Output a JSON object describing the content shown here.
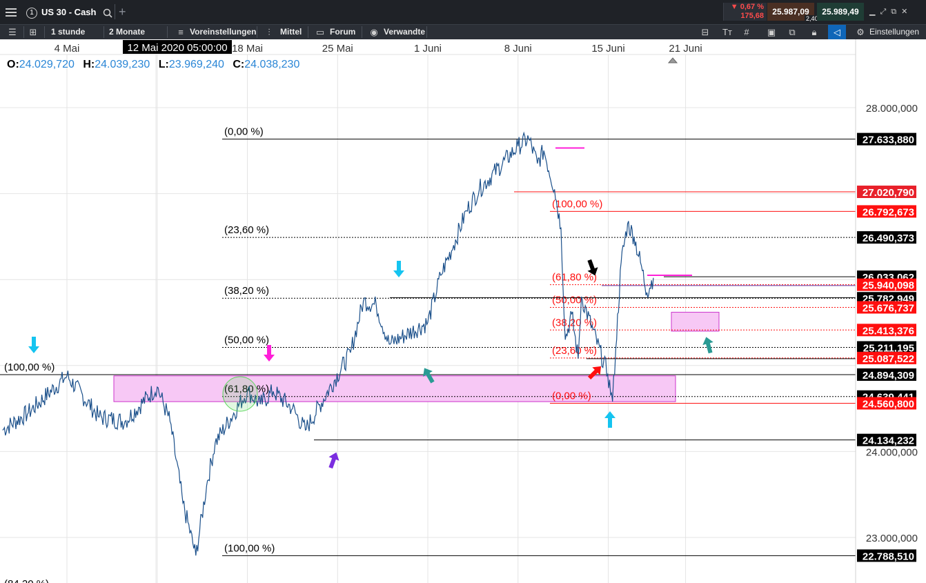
{
  "topbar": {
    "instrument_number": "1",
    "instrument": "US 30 - Cash",
    "change_pct": "0,67 %",
    "change_abs": "175,68",
    "bid": "25.987,09",
    "spread": "2,40",
    "ask": "25.989,49"
  },
  "toolbar": {
    "interval": "1 stunde",
    "range": "2 Monate",
    "presets": "Voreinstellungen",
    "indicator": "Mittel",
    "forum": "Forum",
    "related": "Verwandte",
    "settings": "Einstellungen"
  },
  "ohlc": {
    "o_label": "O:",
    "o_value": "24.029,720",
    "h_label": "H:",
    "h_value": "24.039,230",
    "l_label": "L:",
    "l_value": "23.969,240",
    "c_label": "C:",
    "c_value": "24.038,230"
  },
  "crosshair_date": "12 Mai 2020 05:00:00",
  "chart_data": {
    "type": "line",
    "series": [
      {
        "x": [
          "2020-04-29 00:00",
          "2020-05-01 00:00",
          "2020-05-04 00:00",
          "2020-05-06 12:00",
          "2020-05-08 12:00",
          "2020-05-11 00:00",
          "2020-05-12 00:00",
          "2020-05-13 00:00",
          "2020-05-14 00:00",
          "2020-05-14 20:00",
          "2020-05-15 12:00",
          "2020-05-18 00:00",
          "2020-05-19 00:00",
          "2020-05-20 00:00",
          "2020-05-21 12:00",
          "2020-05-22 12:00",
          "2020-05-26 00:00",
          "2020-05-27 00:00",
          "2020-05-28 00:00",
          "2020-05-29 00:00",
          "2020-06-01 00:00",
          "2020-06-02 00:00",
          "2020-06-03 00:00",
          "2020-06-04 00:00",
          "2020-06-05 00:00",
          "2020-06-08 00:00",
          "2020-06-08 20:00",
          "2020-06-09 12:00",
          "2020-06-10 00:00",
          "2020-06-10 20:00",
          "2020-06-11 08:00",
          "2020-06-11 16:00",
          "2020-06-12 04:00",
          "2020-06-12 16:00",
          "2020-06-12 22:00",
          "2020-06-14 23:00",
          "2020-06-15 08:00",
          "2020-06-15 14:00",
          "2020-06-16 00:00",
          "2020-06-16 12:00",
          "2020-06-17 00:00",
          "2020-06-17 12:00",
          "2020-06-18 00:00",
          "2020-06-18 12:00"
        ],
        "y": [
          24250,
          24450,
          24880,
          24400,
          24350,
          24750,
          24350,
          23400,
          22790,
          23600,
          24100,
          24700,
          24550,
          24700,
          24500,
          24250,
          25150,
          25750,
          25700,
          25250,
          25500,
          26050,
          26400,
          26800,
          27050,
          27550,
          27640,
          27350,
          27500,
          27050,
          26600,
          25300,
          25600,
          25080,
          25800,
          24900,
          24580,
          25200,
          26200,
          26650,
          26500,
          26200,
          25850,
          26020
        ]
      }
    ],
    "ylim": [
      22750,
      28400
    ],
    "yticks": [
      "28.000,000",
      "24.000,000",
      "23.000,000"
    ],
    "xticks": [
      "4 Mai",
      "18 Mai",
      "25 Mai",
      "1 Juni",
      "8 Juni",
      "15 Juni",
      "21 Juni"
    ],
    "fib_set_1": {
      "color": "#000000",
      "levels": [
        {
          "label": "(0,00 %)",
          "value": 27633.88,
          "tag": "27.633,880"
        },
        {
          "label": "(23,60 %)",
          "value": 26490.373,
          "tag": "26.490,373"
        },
        {
          "label": "(38,20 %)",
          "value": 25782.949,
          "tag": "25.782,949"
        },
        {
          "label": "(50,00 %)",
          "value": 25211.195,
          "tag": "25.211,195"
        },
        {
          "label": "(61,80 %)",
          "value": 24639.441,
          "tag": "24.639,441"
        },
        {
          "label": "(100,00 %)",
          "value": 22788.51,
          "tag": "22.788,510"
        }
      ]
    },
    "fib_set_2": {
      "color": "#e8202a",
      "levels": [
        {
          "label": "(100,00 %)",
          "value": 26792.673,
          "tag": "26.792,673"
        },
        {
          "label": "(61,80 %)",
          "value": 25940.098,
          "tag": "25.940,098"
        },
        {
          "label": "(50,00 %)",
          "value": 25676.737,
          "tag": "25.676,737"
        },
        {
          "label": "(38,20 %)",
          "value": 25413.376,
          "tag": "25.413,376"
        },
        {
          "label": "(23,60 %)",
          "value": 25087.522,
          "tag": "25.087,522"
        },
        {
          "label": "(0,00 %)",
          "value": 24560.8,
          "tag": "24.560,800"
        }
      ]
    },
    "other_tags": [
      {
        "value": 27020.79,
        "tag": "27.020,790",
        "color": "#e8202a"
      },
      {
        "value": 26033.062,
        "tag": "26.033,062",
        "color": "#000000"
      },
      {
        "value": 24894.309,
        "tag": "24.894,309",
        "color": "#000000"
      },
      {
        "value": 24134.232,
        "tag": "24.134,232",
        "color": "#000000"
      }
    ],
    "left_label": "(100,00 %)",
    "bottom_left_label": "(84,20 %)",
    "colors": {
      "price": "#1a4f8a",
      "zone": "#f7c8f5",
      "zone_border": "#cc33cc",
      "cyan": "#15c4f0",
      "magenta": "#ff1ed8",
      "teal": "#2a9a94",
      "purple": "#7b2de0",
      "red": "#ff0f0f",
      "black": "#000000",
      "circle": "#5ad65a"
    }
  }
}
